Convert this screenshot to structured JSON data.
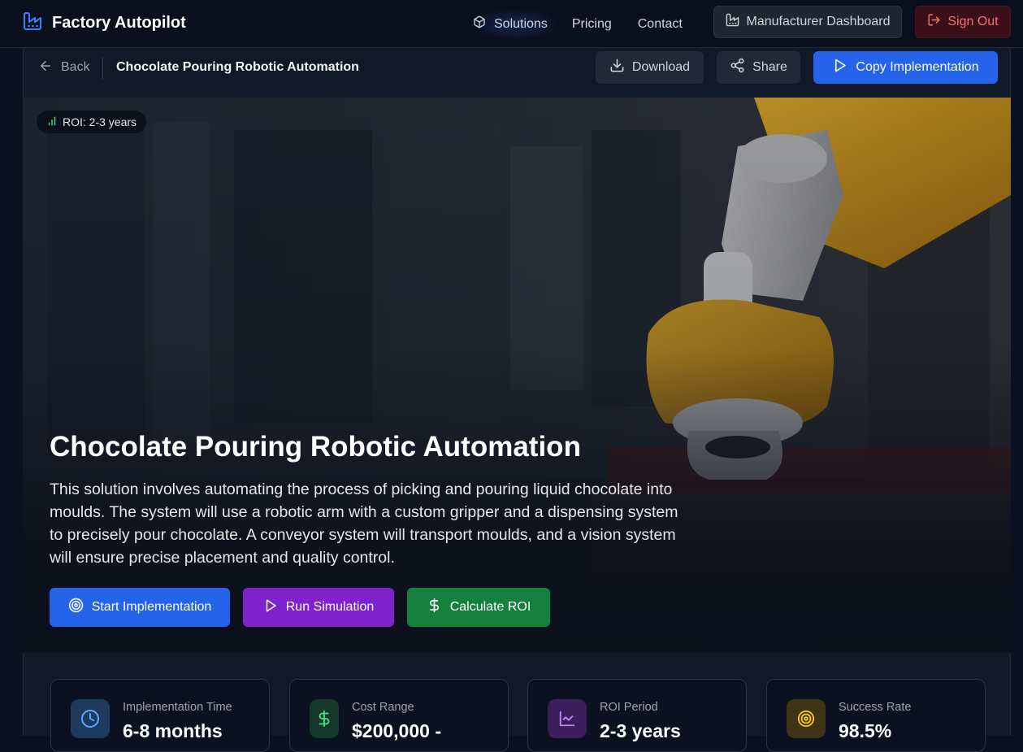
{
  "nav": {
    "brand": "Factory Autopilot",
    "links": [
      {
        "label": "Solutions",
        "icon": "box-icon"
      },
      {
        "label": "Pricing"
      },
      {
        "label": "Contact"
      }
    ],
    "dashboard_label": "Manufacturer Dashboard",
    "signout_label": "Sign Out"
  },
  "subheader": {
    "back_label": "Back",
    "title": "Chocolate Pouring Robotic Automation",
    "download_label": "Download",
    "share_label": "Share",
    "copy_label": "Copy Implementation"
  },
  "hero": {
    "roi_badge": "ROI: 2-3 years",
    "title": "Chocolate Pouring Robotic Automation",
    "description": "This solution involves automating the process of picking and pouring liquid chocolate into moulds. The system will use a robotic arm with a custom gripper and a dispensing system to precisely pour chocolate. A conveyor system will transport moulds, and a vision system will ensure precise placement and quality control.",
    "buttons": {
      "start": "Start Implementation",
      "simulate": "Run Simulation",
      "roi": "Calculate ROI"
    }
  },
  "stats": [
    {
      "label": "Implementation Time",
      "value": "6-8 months",
      "icon": "clock-icon",
      "color": "#60a5fa"
    },
    {
      "label": "Cost Range",
      "value": "$200,000 -",
      "icon": "dollar-icon",
      "color": "#4ade80"
    },
    {
      "label": "ROI Period",
      "value": "2-3 years",
      "icon": "chart-line-icon",
      "color": "#c084fc"
    },
    {
      "label": "Success Rate",
      "value": "98.5%",
      "icon": "target-icon",
      "color": "#facc15"
    }
  ],
  "colors": {
    "primary": "#2563eb",
    "purple": "#7e22ce",
    "green": "#15803d",
    "danger": "#f87171"
  }
}
